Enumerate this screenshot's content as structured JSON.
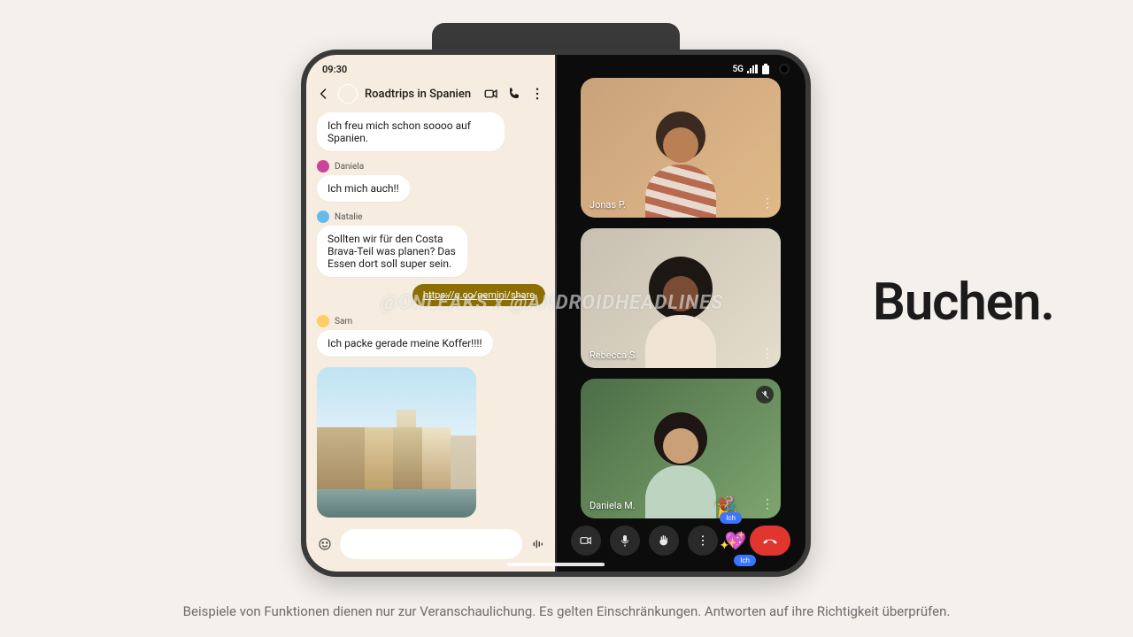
{
  "status": {
    "time": "09:30",
    "network": "5G"
  },
  "chat": {
    "title": "Roadtrips in Spanien",
    "messages": {
      "m1": "Ich freu mich schon soooo auf Spanien.",
      "s2": "Daniela",
      "m2": "Ich mich auch!!",
      "s3": "Natalie",
      "m3": "Sollten wir für den Costa Brava-Teil was planen? Das Essen dort soll super sein.",
      "link": "https://g.co/gemini/share",
      "s4": "Sam",
      "m4": "Ich packe gerade meine Koffer!!!!"
    }
  },
  "call": {
    "participants": {
      "p1": "Jonas P.",
      "p2": "Rebecca S.",
      "p3": "Daniela M."
    },
    "self_label": "Ich"
  },
  "marketing": {
    "headline": "Buchen.",
    "disclaimer": "Beispiele von Funktionen dienen nur zur Veranschaulichung. Es gelten Einschränkungen. Antworten auf ihre Richtigkeit überprüfen."
  },
  "watermark": "@ONLEAKS x @ANDROIDHEADLINES"
}
